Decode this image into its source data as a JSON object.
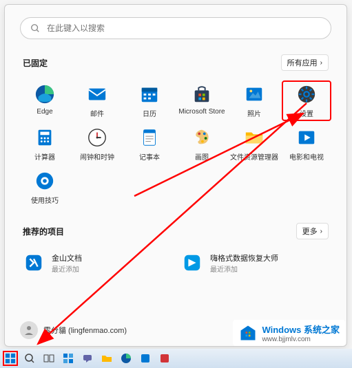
{
  "search": {
    "placeholder": "在此键入以搜索"
  },
  "pinned": {
    "title": "已固定",
    "all_apps": "所有应用",
    "apps": [
      {
        "label": "Edge"
      },
      {
        "label": "邮件"
      },
      {
        "label": "日历"
      },
      {
        "label": "Microsoft Store"
      },
      {
        "label": "照片"
      },
      {
        "label": "设置"
      },
      {
        "label": "计算器"
      },
      {
        "label": "闹钟和时钟"
      },
      {
        "label": "记事本"
      },
      {
        "label": "画图"
      },
      {
        "label": "文件资源管理器"
      },
      {
        "label": "电影和电视"
      },
      {
        "label": "使用技巧"
      }
    ]
  },
  "recommended": {
    "title": "推荐的项目",
    "more": "更多",
    "items": [
      {
        "title": "金山文档",
        "sub": "最近添加"
      },
      {
        "title": "嗨格式数据恢复大师",
        "sub": "最近添加"
      }
    ]
  },
  "user": {
    "name": "零分貓 (lingfenmao.com)"
  },
  "watermark": {
    "title": "Windows 系统之家",
    "sub": "www.bjjmlv.com"
  }
}
